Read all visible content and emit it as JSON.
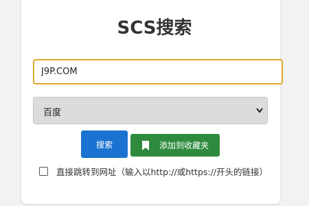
{
  "title": "SCS搜索",
  "search": {
    "value": "J9P.COM",
    "placeholder": ""
  },
  "engine": {
    "selected": "百度"
  },
  "buttons": {
    "search_label": "搜索",
    "favorite_label": "添加到收藏夹"
  },
  "redirect": {
    "label": "直接跳转到网址（输入以http://或https://开头的链接）",
    "checked": false
  },
  "colors": {
    "search_button": "#1b73d1",
    "favorite_button": "#2e8b3e",
    "input_border": "#e0a52a",
    "select_bg": "#dcdcdc"
  },
  "icons": {
    "favorite": "bookmark-icon",
    "select": "chevron-down-icon"
  }
}
